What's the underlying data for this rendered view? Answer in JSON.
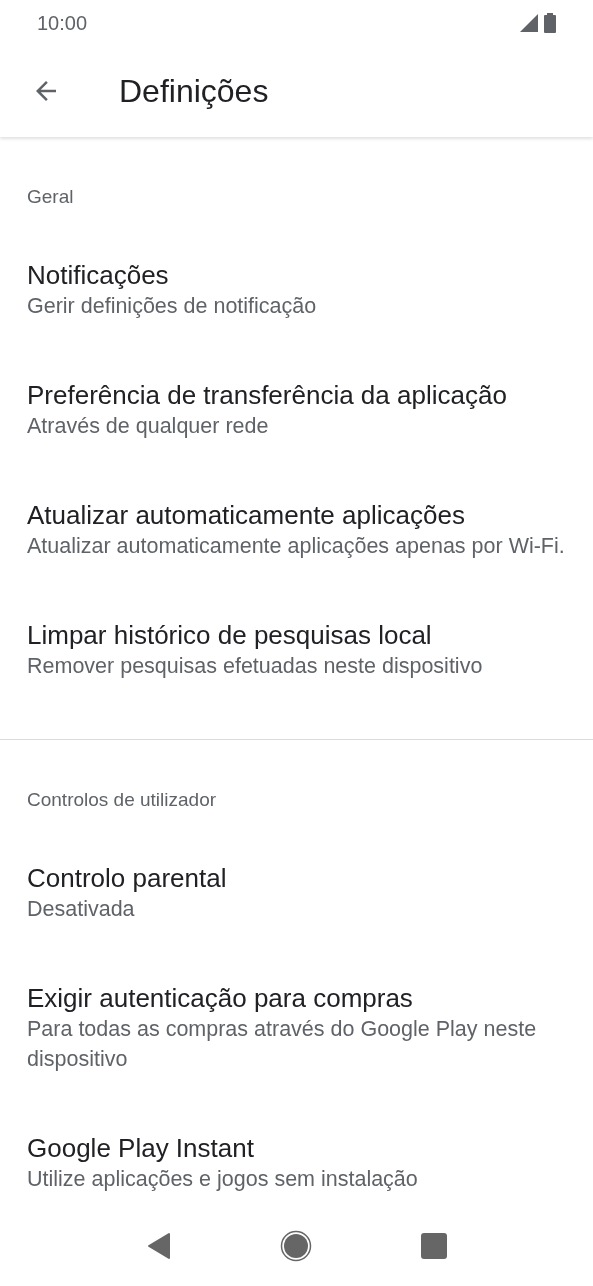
{
  "status_bar": {
    "time": "10:00"
  },
  "app_bar": {
    "title": "Definições"
  },
  "sections": [
    {
      "header": "Geral",
      "items": [
        {
          "title": "Notificações",
          "subtitle": "Gerir definições de notificação"
        },
        {
          "title": "Preferência de transferência da aplicação",
          "subtitle": "Através de qualquer rede"
        },
        {
          "title": "Atualizar automaticamente aplicações",
          "subtitle": "Atualizar automaticamente aplicações apenas por Wi-Fi."
        },
        {
          "title": "Limpar histórico de pesquisas local",
          "subtitle": "Remover pesquisas efetuadas neste dispositivo"
        }
      ]
    },
    {
      "header": "Controlos de utilizador",
      "items": [
        {
          "title": "Controlo parental",
          "subtitle": "Desativada"
        },
        {
          "title": "Exigir autenticação para compras",
          "subtitle": "Para todas as compras através do Google Play neste dispositivo"
        },
        {
          "title": "Google Play Instant",
          "subtitle": "Utilize aplicações e jogos sem instalação"
        }
      ]
    }
  ]
}
